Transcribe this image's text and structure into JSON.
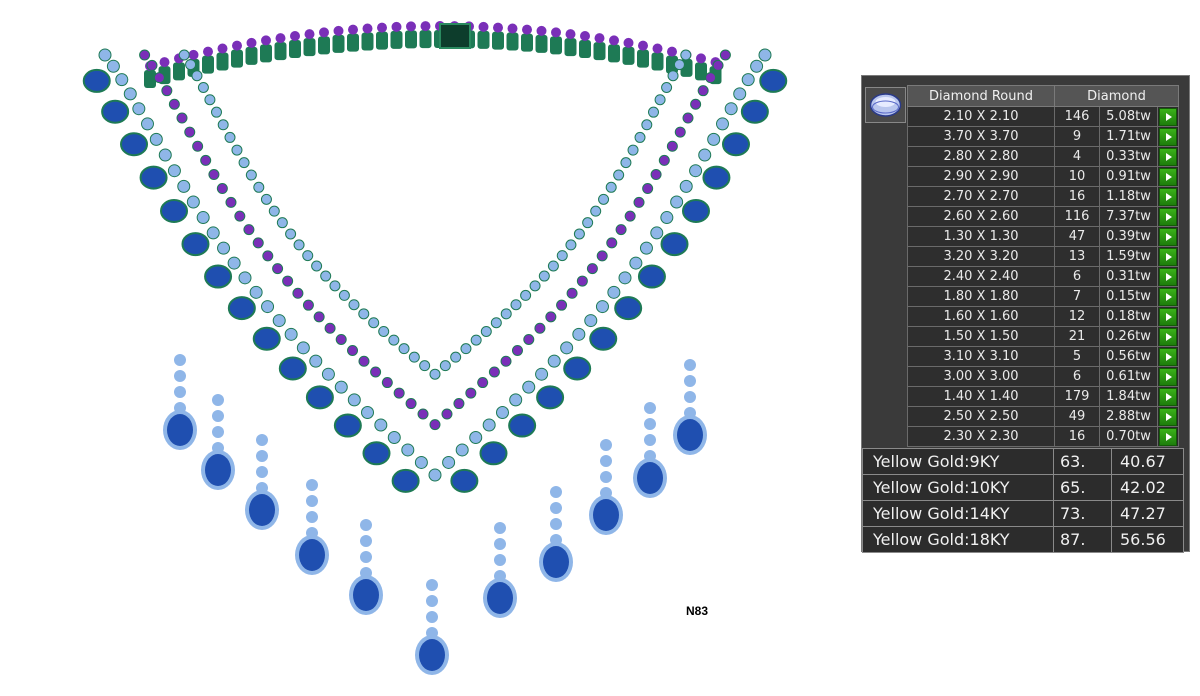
{
  "design": {
    "code": "N83"
  },
  "stone_table": {
    "header_shape": "Diamond Round",
    "header_stone": "Diamond",
    "go_icon": "play-arrow-icon",
    "rows": [
      {
        "size": "2.10 X 2.10",
        "qty": "146",
        "weight": "5.08tw"
      },
      {
        "size": "3.70 X 3.70",
        "qty": "9",
        "weight": "1.71tw"
      },
      {
        "size": "2.80 X 2.80",
        "qty": "4",
        "weight": "0.33tw"
      },
      {
        "size": "2.90 X 2.90",
        "qty": "10",
        "weight": "0.91tw"
      },
      {
        "size": "2.70 X 2.70",
        "qty": "16",
        "weight": "1.18tw"
      },
      {
        "size": "2.60 X 2.60",
        "qty": "116",
        "weight": "7.37tw"
      },
      {
        "size": "1.30 X 1.30",
        "qty": "47",
        "weight": "0.39tw"
      },
      {
        "size": "3.20 X 3.20",
        "qty": "13",
        "weight": "1.59tw"
      },
      {
        "size": "2.40 X 2.40",
        "qty": "6",
        "weight": "0.31tw"
      },
      {
        "size": "1.80 X 1.80",
        "qty": "7",
        "weight": "0.15tw"
      },
      {
        "size": "1.60 X 1.60",
        "qty": "12",
        "weight": "0.18tw"
      },
      {
        "size": "1.50 X 1.50",
        "qty": "21",
        "weight": "0.26tw"
      },
      {
        "size": "3.10 X 3.10",
        "qty": "5",
        "weight": "0.56tw"
      },
      {
        "size": "3.00 X 3.00",
        "qty": "6",
        "weight": "0.61tw"
      },
      {
        "size": "1.40 X 1.40",
        "qty": "179",
        "weight": "1.84tw"
      },
      {
        "size": "2.50 X 2.50",
        "qty": "49",
        "weight": "2.88tw"
      },
      {
        "size": "2.30 X 2.30",
        "qty": "16",
        "weight": "0.70tw"
      }
    ]
  },
  "metal_table": {
    "rows": [
      {
        "name": "Yellow Gold:9KY",
        "w1": "63.",
        "w2": "40.67"
      },
      {
        "name": "Yellow Gold:10KY",
        "w1": "65.",
        "w2": "42.02"
      },
      {
        "name": "Yellow Gold:14KY",
        "w1": "73.",
        "w2": "47.27"
      },
      {
        "name": "Yellow Gold:18KY",
        "w1": "87.",
        "w2": "56.56"
      }
    ]
  },
  "colors": {
    "panel_bg": "#3a3a3a",
    "go_button": "#2e9c14",
    "gem_blue": "#1f4fb0",
    "halo_light_blue": "#8fb6e8",
    "setting_purple": "#7a2fb8",
    "setting_green": "#1e7a55"
  }
}
